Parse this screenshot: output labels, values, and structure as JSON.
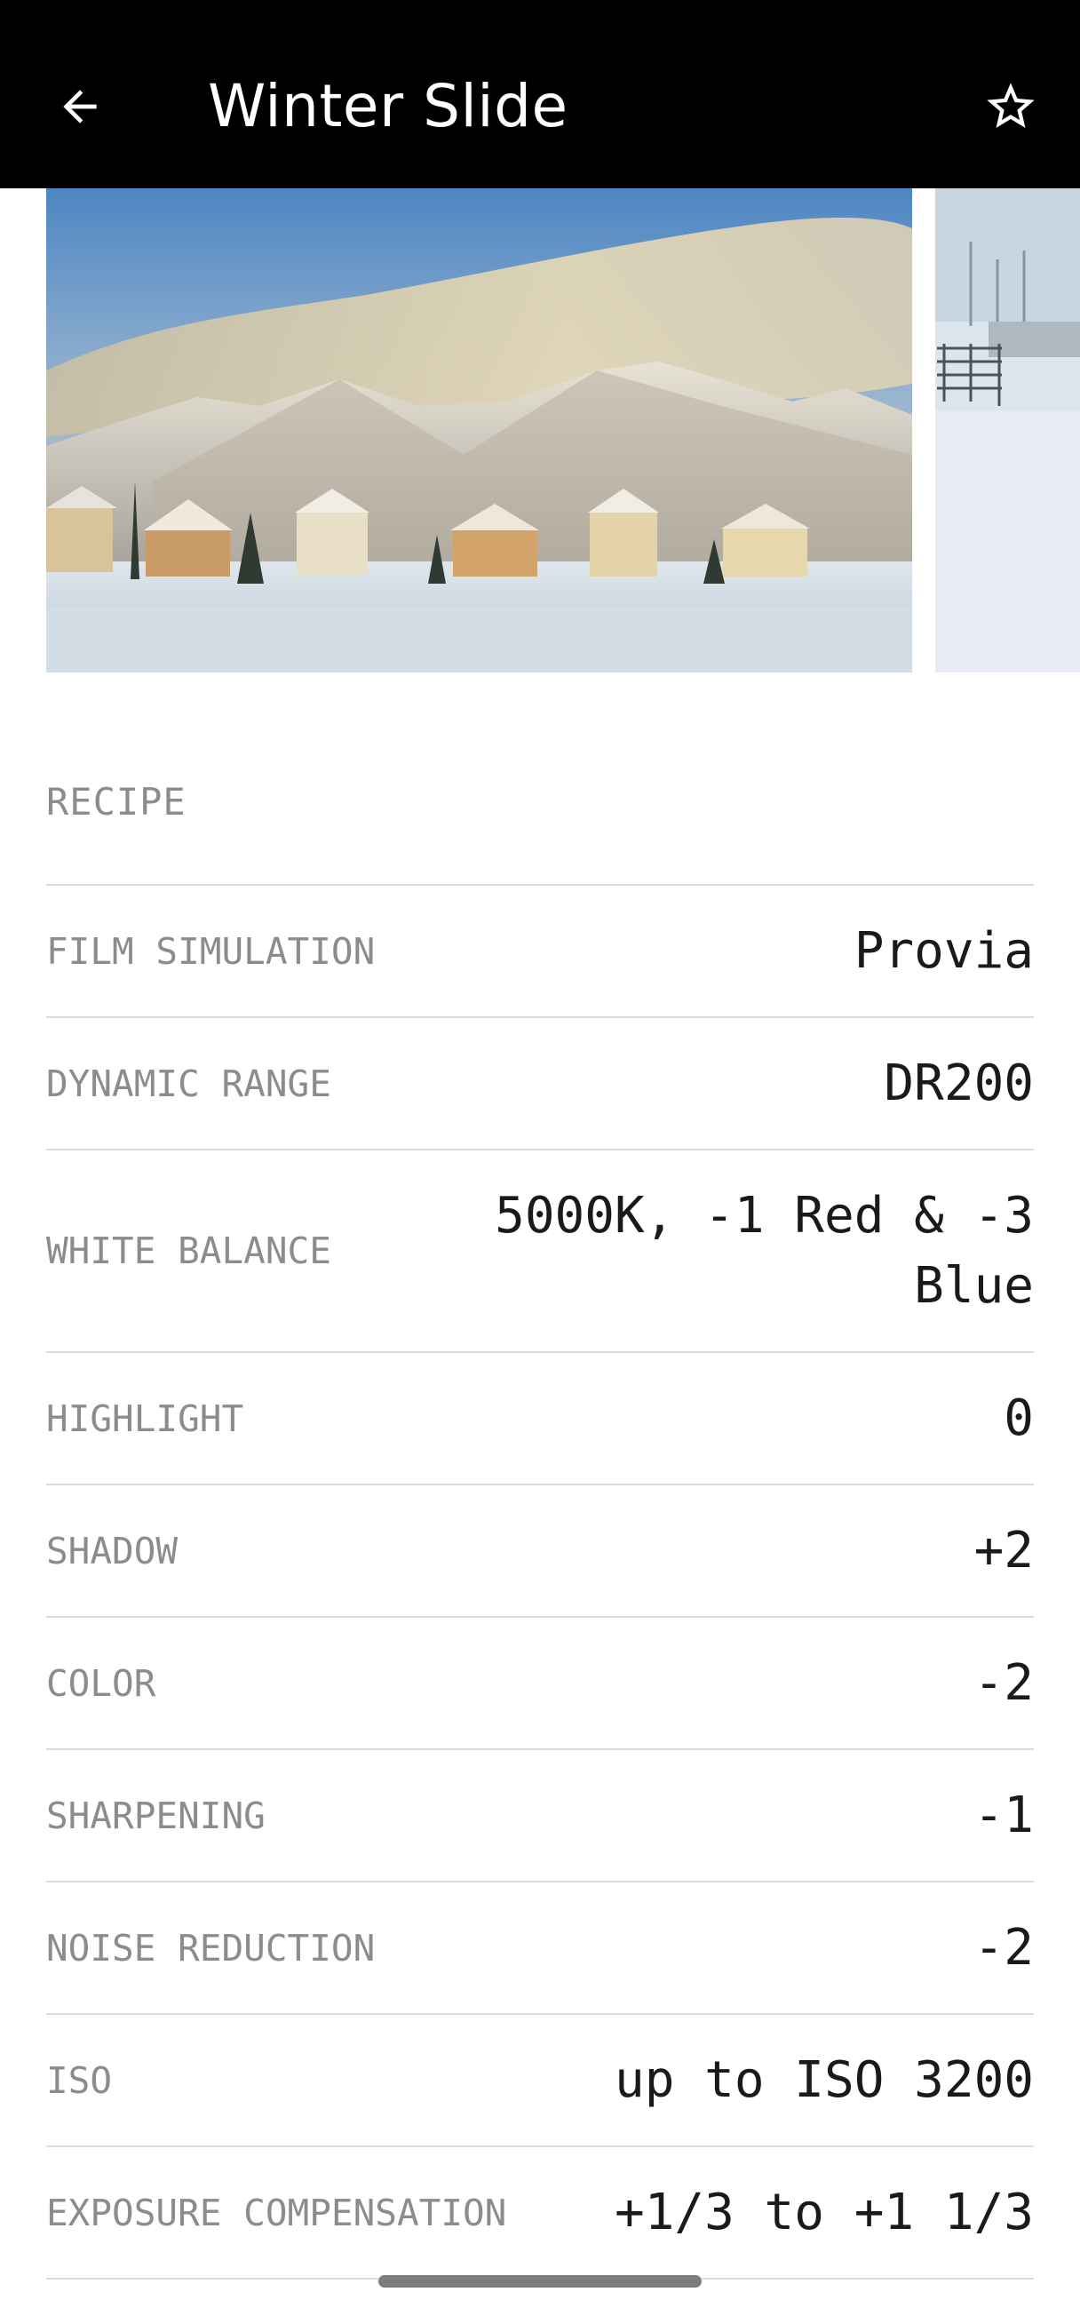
{
  "app_bar": {
    "title": "Winter Slide",
    "back_icon": "arrow-back-icon",
    "favorite_icon": "star-outline-icon"
  },
  "carousel": {
    "images": [
      {
        "subject": "Snow-covered mountains behind a row of houses at sunset"
      },
      {
        "subject": "Snowy field with a fence"
      }
    ]
  },
  "recipe": {
    "section_label": "RECIPE",
    "settings": [
      {
        "label": "FILM SIMULATION",
        "value": "Provia"
      },
      {
        "label": "DYNAMIC RANGE",
        "value": "DR200"
      },
      {
        "label": "WHITE BALANCE",
        "value": "5000K, -1 Red & -3 Blue"
      },
      {
        "label": "HIGHLIGHT",
        "value": "0"
      },
      {
        "label": "SHADOW",
        "value": "+2"
      },
      {
        "label": "COLOR",
        "value": "-2"
      },
      {
        "label": "SHARPENING",
        "value": "-1"
      },
      {
        "label": "NOISE REDUCTION",
        "value": "-2"
      },
      {
        "label": "ISO",
        "value": "up to ISO 3200"
      },
      {
        "label": "EXPOSURE COMPENSATION",
        "value": "+1/3 to +1 1/3"
      }
    ]
  },
  "colors": {
    "app_bar_bg": "#000000",
    "title_text": "#ffffff",
    "label_text": "#8c8c8c",
    "value_text": "#1a1a1a",
    "divider": "#dcdcdc"
  }
}
